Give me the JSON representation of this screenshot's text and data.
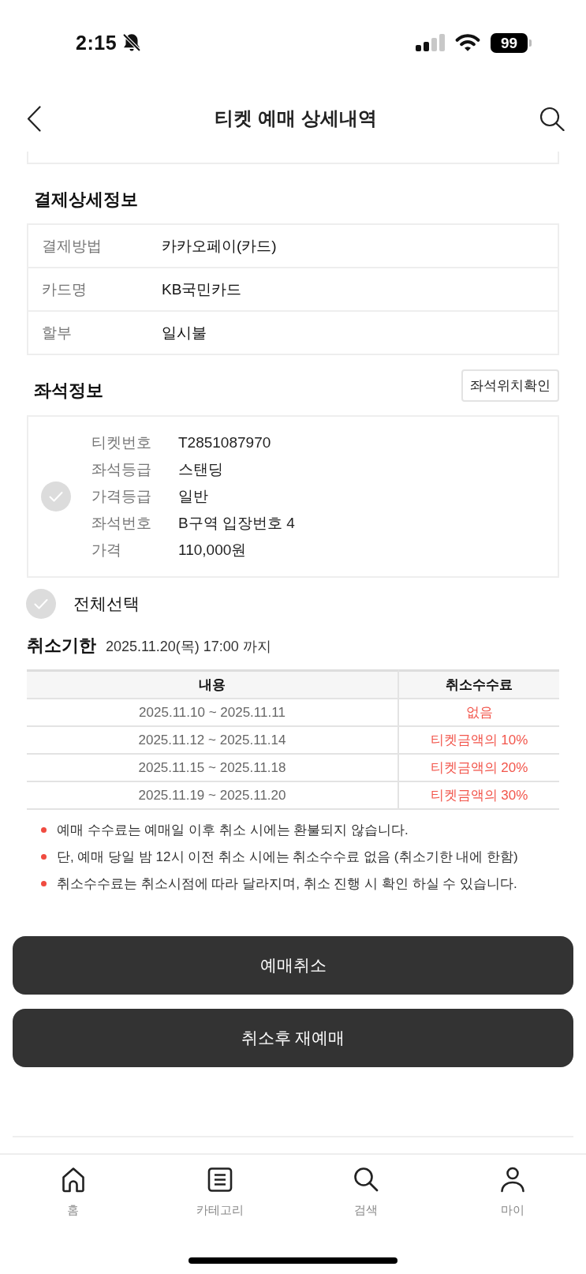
{
  "status_bar": {
    "time": "2:15",
    "battery": "99"
  },
  "header": {
    "title": "티켓 예매 상세내역"
  },
  "payment": {
    "title": "결제상세정보",
    "rows": [
      {
        "label": "결제방법",
        "value": "카카오페이(카드)"
      },
      {
        "label": "카드명",
        "value": "KB국민카드"
      },
      {
        "label": "할부",
        "value": "일시불"
      }
    ]
  },
  "seats": {
    "title": "좌석정보",
    "map_button": "좌석위치확인",
    "tickets": [
      {
        "checked": false,
        "fields": [
          {
            "label": "티켓번호",
            "value": "T2851087970"
          },
          {
            "label": "좌석등급",
            "value": "스탠딩"
          },
          {
            "label": "가격등급",
            "value": "일반"
          },
          {
            "label": "좌석번호",
            "value": "B구역 입장번호 4"
          },
          {
            "label": "가격",
            "value": "110,000원"
          }
        ]
      }
    ]
  },
  "select_all": {
    "label": "전체선택",
    "checked": false
  },
  "cancel_deadline": {
    "label": "취소기한",
    "value": "2025.11.20(목) 17:00 까지"
  },
  "fee_table": {
    "columns": [
      "내용",
      "취소수수료"
    ],
    "rows": [
      {
        "period": "2025.11.10 ~ 2025.11.11",
        "fee": "없음"
      },
      {
        "period": "2025.11.12 ~ 2025.11.14",
        "fee": "티켓금액의 10%"
      },
      {
        "period": "2025.11.15 ~ 2025.11.18",
        "fee": "티켓금액의 20%"
      },
      {
        "period": "2025.11.19 ~ 2025.11.20",
        "fee": "티켓금액의 30%"
      }
    ]
  },
  "notes": [
    "예매 수수료는 예매일 이후 취소 시에는 환불되지 않습니다.",
    "단, 예매 당일 밤 12시 이전 취소 시에는 취소수수료 없음 (취소기한 내에 한함)",
    "취소수수료는 취소시점에 따라 달라지며, 취소 진행 시 확인 하실 수 있습니다."
  ],
  "buttons": [
    {
      "label": "예매취소"
    },
    {
      "label": "취소후 재예매"
    }
  ],
  "bottom_nav": [
    {
      "kind": "home",
      "label": "홈"
    },
    {
      "kind": "category",
      "label": "카테고리"
    },
    {
      "kind": "search",
      "label": "검색"
    },
    {
      "kind": "my",
      "label": "마이"
    }
  ]
}
